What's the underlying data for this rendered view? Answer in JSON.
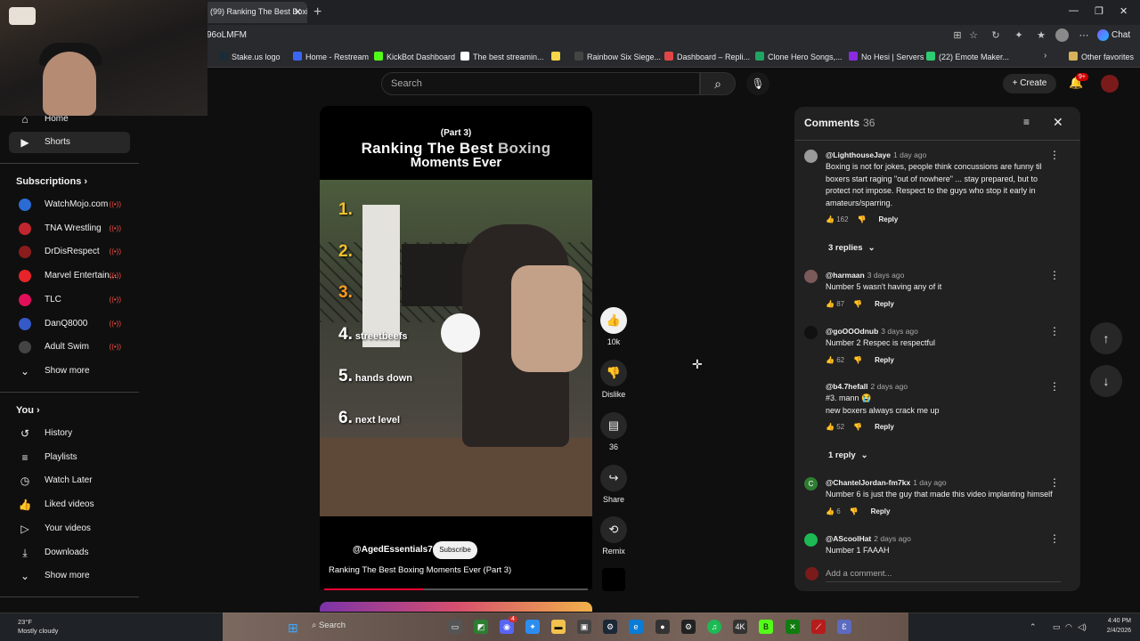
{
  "browser": {
    "tab_title": "(99) Ranking The Best Boxing",
    "url": "96oLMFM",
    "chat_label": "Chat",
    "bookmarks": [
      {
        "label": "Stake.us logo",
        "color": "#1a2c38"
      },
      {
        "label": "Home - Restream",
        "color": "#3b66f5"
      },
      {
        "label": "KickBot Dashboard",
        "color": "#53fc18"
      },
      {
        "label": "The best streamin...",
        "color": "#ffffff"
      },
      {
        "label": "",
        "color": "#f7d54a"
      },
      {
        "label": "Rainbow Six Siege...",
        "color": "#444444"
      },
      {
        "label": "Dashboard – Repli...",
        "color": "#e04646"
      },
      {
        "label": "Clone Hero Songs,...",
        "color": "#1fa463"
      },
      {
        "label": "No Hesi | Servers",
        "color": "#8a2be2"
      },
      {
        "label": "(22) Emote Maker...",
        "color": "#2ecc71"
      }
    ],
    "other_favorites": "Other favorites"
  },
  "header": {
    "search_placeholder": "Search",
    "create_label": "Create",
    "notif_badge": "9+"
  },
  "sidebar": {
    "home": "Home",
    "shorts": "Shorts",
    "subscriptions_title": "Subscriptions",
    "subscriptions": [
      {
        "name": "WatchMojo.com",
        "color": "#2a6cd3"
      },
      {
        "name": "TNA Wrestling",
        "color": "#c0262d"
      },
      {
        "name": "DrDisRespect",
        "color": "#8b1c1c"
      },
      {
        "name": "Marvel Entertain...",
        "color": "#e62429"
      },
      {
        "name": "TLC",
        "color": "#e10f5a"
      },
      {
        "name": "DanQ8000",
        "color": "#3559c7"
      },
      {
        "name": "Adult Swim",
        "color": "#444444"
      }
    ],
    "show_more": "Show more",
    "you_title": "You",
    "you_items": [
      "History",
      "Playlists",
      "Watch Later",
      "Liked videos",
      "Your videos",
      "Downloads",
      "Show more"
    ]
  },
  "short": {
    "overlay_part": "(Part 3)",
    "overlay_title_a": "Ranking The Best ",
    "overlay_title_b": "Boxing",
    "overlay_title_2": "Moments Ever",
    "ranks": [
      {
        "num": "1.",
        "label": ""
      },
      {
        "num": "2.",
        "label": ""
      },
      {
        "num": "3.",
        "label": ""
      },
      {
        "num": "4.",
        "label": "streetbeefs"
      },
      {
        "num": "5.",
        "label": "hands down"
      },
      {
        "num": "6.",
        "label": "next level"
      }
    ],
    "channel": "@AgedEssentials70",
    "subscribe": "Subscribe",
    "title": "Ranking The Best Boxing Moments Ever (Part 3)",
    "progress": 0.38,
    "likes": "10k",
    "dislike": "Dislike",
    "comments_count": "36",
    "share": "Share",
    "remix": "Remix"
  },
  "comments": {
    "title": "Comments",
    "count": "36",
    "add_placeholder": "Add a comment...",
    "items": [
      {
        "user": "@LighthouseJaye",
        "time": "1 day ago",
        "text": "Boxing is not for jokes, people think concussions are funny til boxers start raging \"out of nowhere\" ... stay prepared, but to protect not impose. Respect to the guys who stop it early in amateurs/sparring.",
        "likes": "162",
        "reply": "Reply",
        "replies": "3 replies",
        "avatar": "#9a9a9a"
      },
      {
        "user": "@harmaan",
        "time": "3 days ago",
        "text": "Number 5 wasn't having any of it",
        "likes": "87",
        "reply": "Reply",
        "replies": "",
        "avatar": "#7d5a5a"
      },
      {
        "user": "@goOOOdnub",
        "time": "3 days ago",
        "text": "Number 2 Respec is respectful",
        "likes": "62",
        "reply": "Reply",
        "replies": "",
        "avatar": "#111111"
      },
      {
        "user": "@b4.7hefall",
        "time": "2 days ago",
        "text": "#3. mann 😭\nnew boxers always crack me up",
        "likes": "52",
        "reply": "Reply",
        "replies": "1 reply",
        "avatar": "#212121"
      },
      {
        "user": "@ChantelJordan-fm7kx",
        "time": "1 day ago",
        "text": "Number 6 is just the guy that made this video implanting himself",
        "likes": "6",
        "reply": "Reply",
        "replies": "",
        "avatar": "#2e7d32",
        "initial": "C"
      },
      {
        "user": "@AScoolHat",
        "time": "2 days ago",
        "text": "Number 1 FAAAH",
        "likes": "",
        "reply": "",
        "replies": "",
        "avatar": "#1db954"
      }
    ]
  },
  "taskbar": {
    "temp": "23°F",
    "weather": "Mostly cloudy",
    "search": "Search",
    "time": "4:40 PM",
    "date": "2/4/2026",
    "app_badge": "4"
  },
  "colors": {
    "accent": "#ff0033",
    "like_active": "#f1f1f1",
    "panel": "#212121"
  }
}
